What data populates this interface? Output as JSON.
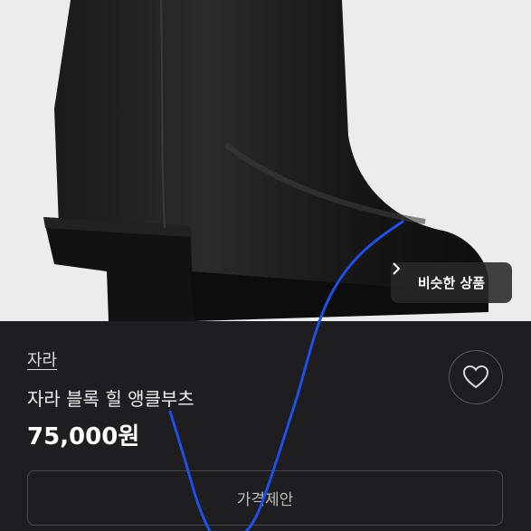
{
  "product": {
    "brand": "자라",
    "title": "자라 블록 힐 앵클부츠",
    "price": "75,000원"
  },
  "overlay": {
    "similar_label": "비슷한 상품"
  },
  "actions": {
    "offer_label": "가격제안"
  },
  "icons": {
    "heart": "heart-icon",
    "chevron": "chevron-right-icon"
  },
  "colors": {
    "background": "#1e1e20",
    "scribble": "#1e4fe6"
  }
}
